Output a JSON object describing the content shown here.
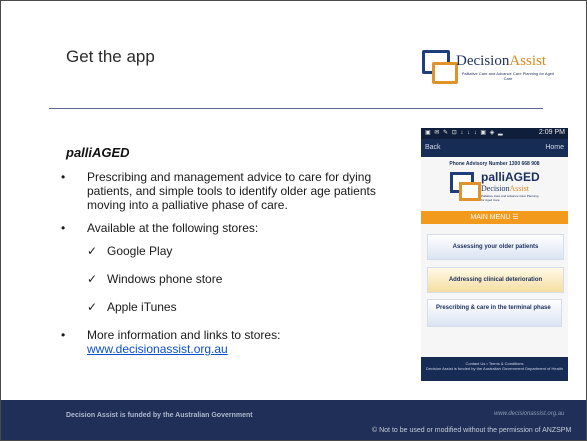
{
  "slide": {
    "title": "Get the app",
    "subtitle": "palliAGED",
    "logo": {
      "name_main": "Decision",
      "name_accent": "Assist",
      "tagline": "Palliative Care and Advance Care Planning for Aged Care"
    }
  },
  "content": {
    "bullet_marker": "•",
    "check_marker": "✓",
    "bullets": [
      "Prescribing and management advice to care for dying patients, and simple tools to identify older age patients moving into a palliative phase of care.",
      "Available at the following stores:"
    ],
    "stores": [
      "Google Play",
      "Windows phone store",
      "Apple iTunes"
    ],
    "more_info": "More information and links to stores:",
    "link": "www.decisionassist.org.au"
  },
  "phone": {
    "status_icons": "▣ ✉ ✎ ⊡ ↓ ↓ ↓ ▣ ◈ ▂",
    "status_time": "2:09 PM",
    "back_label": "Back",
    "home_label": "Home",
    "advisory_line": "Phone Advisory Number 1300 668 908",
    "app_name": "palliAGED",
    "brand_main": "Decision",
    "brand_accent": "Assist",
    "brand_tagline": "Palliative Care and Advance Care Planning for Aged Care",
    "menu_label": "MAIN MENU ☰",
    "cards": [
      "Assessing your older patients",
      "Addressing clinical deterioration",
      "Prescribing & care in the terminal phase"
    ],
    "footer_links": "Contact Us • Terms & Conditions",
    "footer_note": "Decision Assist is funded by the Australian Government Department of Health"
  },
  "footer": {
    "funding": "Decision Assist is funded by the Australian Government",
    "website": "www.decisionassist.org.au",
    "copyright": "© Not to be used or modified without the permission of ANZSPM"
  },
  "colors": {
    "navy": "#1f2f57",
    "orange": "#f19a1c",
    "link": "#0b4fd1"
  }
}
